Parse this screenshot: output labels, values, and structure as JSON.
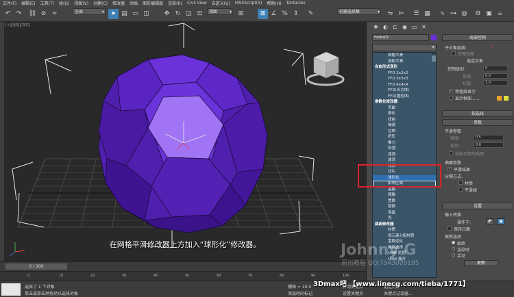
{
  "menu": [
    "文件(F)",
    "编辑(E)",
    "工具(T)",
    "组(G)",
    "视图(V)",
    "创建(C)",
    "修改器",
    "动画",
    "图形编辑器",
    "渲染(R)",
    "Civil View",
    "自定义(U)",
    "MAXScript(X)",
    "帮助(H)",
    "Tentacles"
  ],
  "toolbar": {
    "filter_select": "全部",
    "view_select": "视图",
    "selset_select": "创建选择集"
  },
  "viewport": {
    "label": "[+][透视][真实]",
    "subtitle": "在网格平滑修改器上方加入“球形化”修改器。"
  },
  "command_panel": {
    "object_name": "Hedra01",
    "modifier_list": [
      {
        "text": "网格平滑",
        "kind": "item"
      },
      {
        "text": "涡轮平滑",
        "kind": "item"
      },
      {
        "text": "自由形式变形",
        "kind": "cat"
      },
      {
        "text": "FFD 2x2x2",
        "kind": "item"
      },
      {
        "text": "FFD 3x3x3",
        "kind": "item"
      },
      {
        "text": "FFD 4x4x4",
        "kind": "item"
      },
      {
        "text": "FFD(长方体)",
        "kind": "item"
      },
      {
        "text": "FFD(圆柱体)",
        "kind": "item"
      },
      {
        "text": "参数化修改器",
        "kind": "cat"
      },
      {
        "text": "弯曲",
        "kind": "item"
      },
      {
        "text": "锥化",
        "kind": "item"
      },
      {
        "text": "扭曲",
        "kind": "item"
      },
      {
        "text": "噪波",
        "kind": "item"
      },
      {
        "text": "拉伸",
        "kind": "item"
      },
      {
        "text": "挤压",
        "kind": "item"
      },
      {
        "text": "推力",
        "kind": "item"
      },
      {
        "text": "松弛",
        "kind": "item"
      },
      {
        "text": "涟漪",
        "kind": "item"
      },
      {
        "text": "波浪",
        "kind": "item"
      },
      {
        "text": "倾斜",
        "kind": "item"
      },
      {
        "text": "切片",
        "kind": "item"
      },
      {
        "text": "球形化",
        "kind": "item",
        "selected": true
      },
      {
        "text": "影响区域",
        "kind": "item",
        "hover": true
      },
      {
        "text": "晶格",
        "kind": "item"
      },
      {
        "text": "镜像",
        "kind": "item"
      },
      {
        "text": "置换",
        "kind": "item"
      },
      {
        "text": "替换",
        "kind": "item"
      },
      {
        "text": "保留",
        "kind": "item"
      },
      {
        "text": "壳",
        "kind": "item"
      },
      {
        "text": "曲面修改器",
        "kind": "cat"
      },
      {
        "text": "材质",
        "kind": "item"
      },
      {
        "text": "按元素分配材质",
        "kind": "item"
      },
      {
        "text": "置换近似",
        "kind": "item"
      },
      {
        "text": "网格选择",
        "kind": "item"
      },
      {
        "text": "UVW 贴图",
        "kind": "item"
      },
      {
        "text": "UVW 展开",
        "kind": "item"
      }
    ]
  },
  "props": {
    "local_control": "局部控制",
    "subobject_level": "子对象层级:",
    "ignore_backfacing": "忽略背面",
    "select_object": "选定对象",
    "control_level": "控制级别:",
    "control_level_value": "0",
    "crease": "折缝:",
    "crease_value": "0.0",
    "weight": "权重:",
    "weight_value": "1.0",
    "isoline_display": "等值线显示",
    "show_cage": "显示框架......",
    "soft_selection": "软选择",
    "parameters": "参数",
    "smooth_params": "平滑参数",
    "strength": "强度:",
    "strength_value": "0.5",
    "relax": "松弛:",
    "relax_value": "0.0",
    "project_limit": "投影到限制曲面",
    "surface_params": "曲面参数",
    "smooth_result": "平滑结果",
    "separate_by": "分隔方式:",
    "materials": "材质",
    "smoothing_groups": "平滑组",
    "settings": "设置",
    "input_conversion": "输入转换",
    "operate_on": "操作于:",
    "keep_convex": "保持凸面",
    "update_options": "更新选项",
    "always": "始终",
    "when_rendering": "渲染时",
    "manually": "手动",
    "update_button": "更新"
  },
  "timeline": {
    "slider": "0 / 100"
  },
  "ruler_ticks": [
    "0",
    "10",
    "20",
    "30",
    "40",
    "50",
    "60",
    "70",
    "80",
    "90",
    "100"
  ],
  "status": {
    "selected": "选择了 1 个对象",
    "hint": "单击或单击并拖动以选择对象",
    "grid": "栅格 = 10.0",
    "add_time_tag": "添加时间标记",
    "auto_key": "自动关键点",
    "set_key": "设置关键点",
    "selected_obj": "选定对象",
    "key_filter": "关键点过滤器..."
  },
  "overlay": {
    "watermark": "Johnny G",
    "watermark_sub": "原创教程 QQ:7943009195",
    "url_tag": "3Dmax吧 【www.linecg.com/tieba/1771】"
  },
  "colors": {
    "object": "#6a2fd6",
    "highlight_face": "#b07cff",
    "selection_box": "#e0222a",
    "accent": "#3e7fb2"
  }
}
